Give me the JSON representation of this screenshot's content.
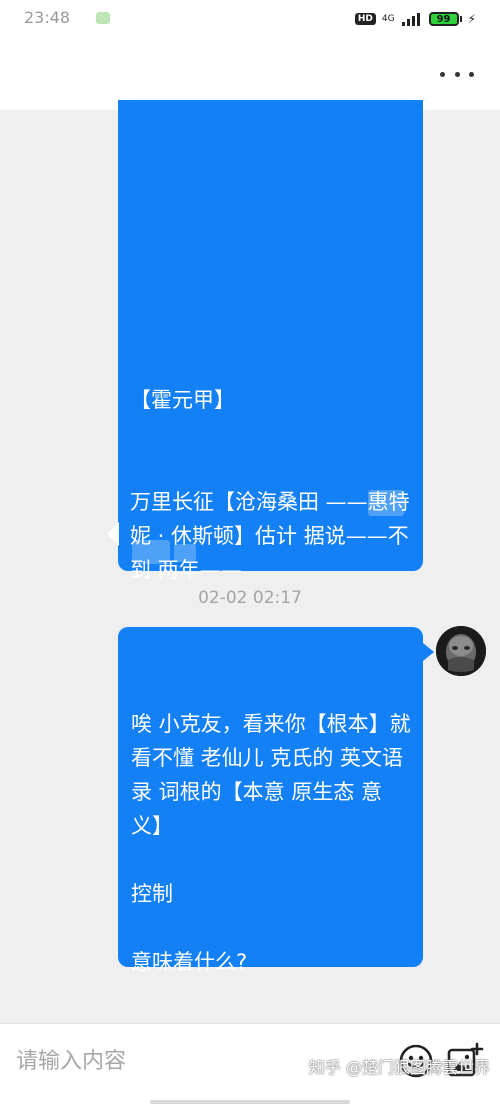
{
  "status_bar": {
    "time": "23:48",
    "hd_badge": "HD",
    "network": "4G",
    "battery": "99",
    "charge_icon": "lightning-icon"
  },
  "app_bar": {
    "more_icon": "more-horizontal-icon"
  },
  "messages": [
    {
      "direction": "incoming",
      "text": "【霍元甲】\n\n\n万里长征【沧海桑田 ——惠特妮 · 休斯顿】估计 据说——不到 两年——"
    },
    {
      "direction": "outgoing",
      "timestamp": "02-02 02:17",
      "text": "唉 小克友，看来你【根本】就看不懂 老仙儿 克氏的 英文语录 词根的【本意 原生态 意义】\n\n控制\n\n意味着什么?"
    }
  ],
  "input_bar": {
    "placeholder": "请输入内容",
    "emoji_icon": "emoji-icon",
    "image_icon": "add-image-icon"
  },
  "watermark": "知乎 @楚门狠图腾雲世界",
  "colors": {
    "bubble": "#1480f5",
    "background": "#efefef"
  }
}
